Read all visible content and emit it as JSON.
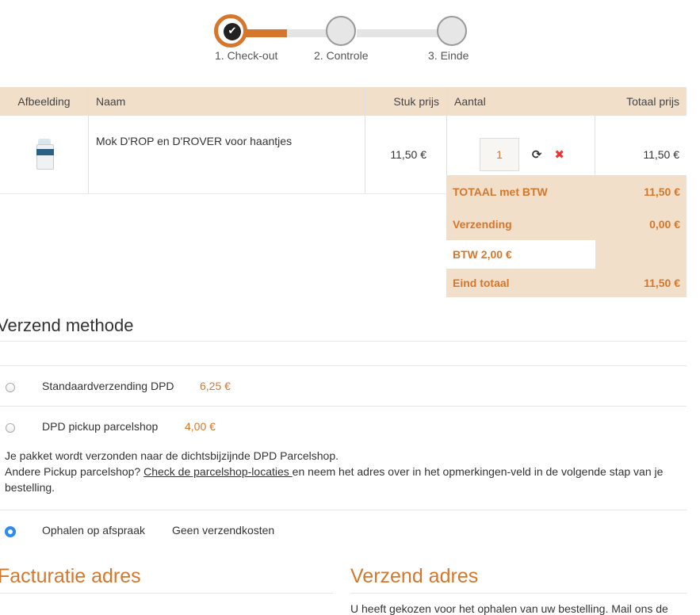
{
  "stepper": {
    "steps": [
      {
        "label": "1. Check-out",
        "state": "done"
      },
      {
        "label": "2. Controle",
        "state": "pending"
      },
      {
        "label": "3. Einde",
        "state": "pending"
      }
    ],
    "accent": "#d4772c"
  },
  "cart": {
    "headers": {
      "image": "Afbeelding",
      "name": "Naam",
      "unit_price": "Stuk prijs",
      "quantity": "Aantal",
      "total_price": "Totaal prijs"
    },
    "items": [
      {
        "name": "Mok D'ROP en D'ROVER voor haantjes",
        "unit_price": "11,50 €",
        "quantity": "1",
        "total": "11,50 €"
      }
    ]
  },
  "totals": {
    "total_incl_label": "TOTAAL met BTW",
    "total_incl_value": "11,50 €",
    "shipping_label": "Verzending",
    "shipping_value": "0,00 €",
    "vat_label": "BTW",
    "vat_value": "2,00 €",
    "grand_label": "Eind totaal",
    "grand_value": "11,50 €"
  },
  "shipping_method": {
    "title": "Verzend methode",
    "options": [
      {
        "label": "Standaardverzending DPD",
        "price": "6,25 €",
        "selected": false
      },
      {
        "label": "DPD pickup parcelshop",
        "price": "4,00 €",
        "selected": false
      },
      {
        "label": "Ophalen op afspraak",
        "price": "Geen verzendkosten",
        "selected": true
      }
    ],
    "note_line1": "Je pakket wordt verzonden naar de dichtsbijzijnde DPD Parcelshop.",
    "note_line2_pre": "Andere Pickup parcelshop? ",
    "note_link": "Check de parcelshop-locaties ",
    "note_line2_post": " en neem het adres over in het opmerkingen-veld in de volgende stap van je bestelling."
  },
  "billing": {
    "title": "Facturatie adres"
  },
  "delivery": {
    "title": "Verzend adres",
    "text": "U heeft gekozen voor het ophalen van uw bestelling. Mail ons de"
  }
}
